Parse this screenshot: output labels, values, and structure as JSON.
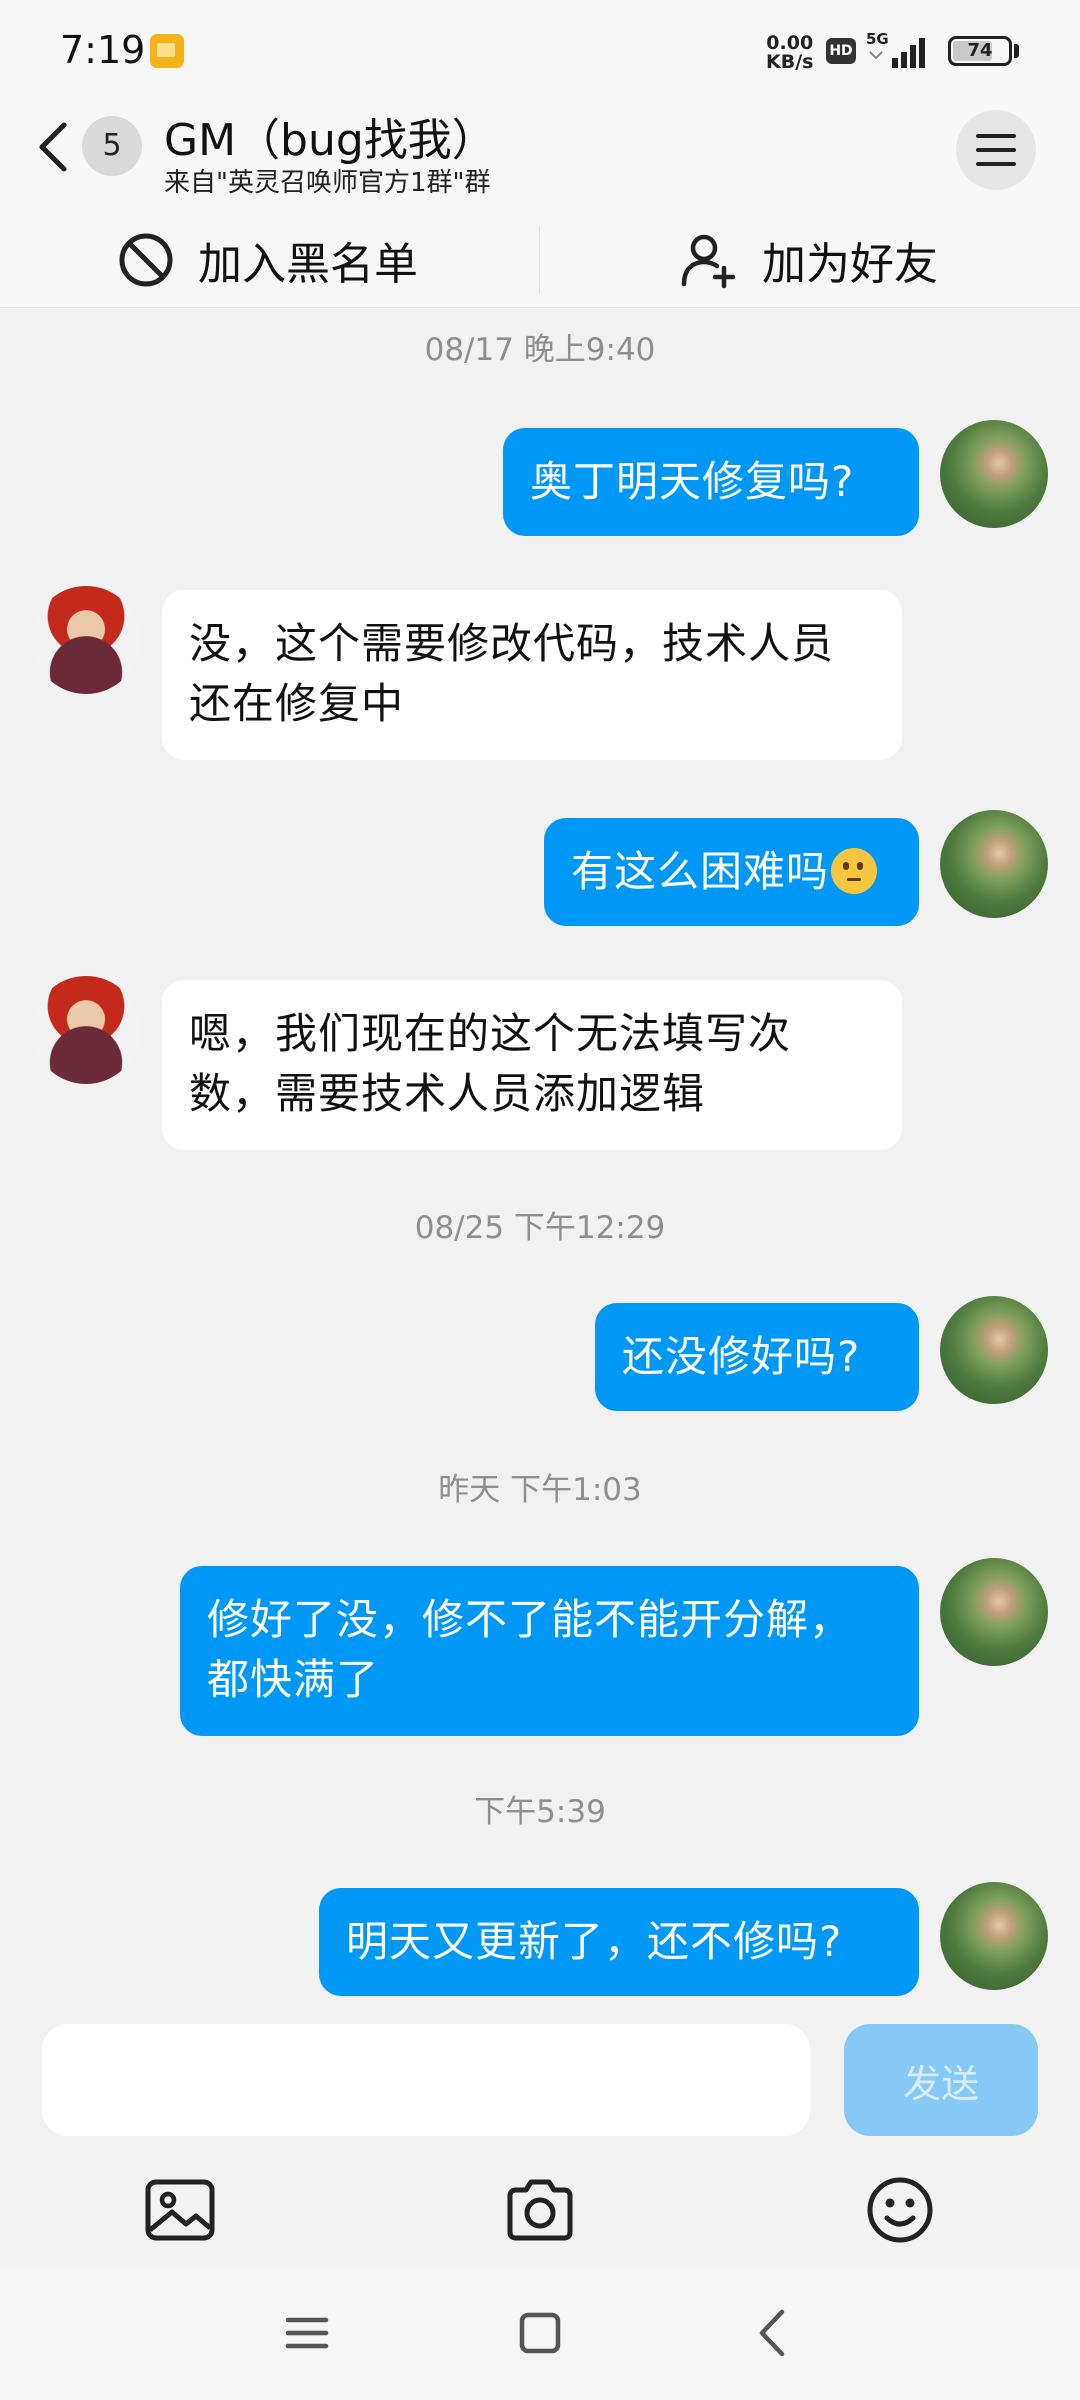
{
  "status_bar": {
    "time": "7:19",
    "speed_value": "0.00",
    "speed_unit": "KB/s",
    "hd_badge": "HD",
    "network": "5G",
    "battery": "74",
    "battery_level": 0.74
  },
  "header": {
    "unread_count": "5",
    "title": "GM（bug找我）",
    "subtitle": "来自\"英灵召唤师官方1群\"群",
    "back_icon": "chevron-left-icon",
    "menu_icon": "hamburger-menu-icon"
  },
  "actions": {
    "block_label": "加入黑名单",
    "block_icon": "block-icon",
    "add_friend_label": "加为好友",
    "add_friend_icon": "add-user-icon"
  },
  "messages": [
    {
      "type": "time",
      "text": "08/17 晚上9:40"
    },
    {
      "type": "out",
      "text": "奥丁明天修复吗?"
    },
    {
      "type": "in",
      "lines": [
        "没，这个需要修改代码，技术人员",
        "还在修复中"
      ]
    },
    {
      "type": "out",
      "text": "有这么困难吗",
      "emoji": "thinking-face-emoji"
    },
    {
      "type": "in",
      "lines": [
        "嗯，我们现在的这个无法填写次",
        "数，需要技术人员添加逻辑"
      ]
    },
    {
      "type": "time",
      "text": "08/25 下午12:29"
    },
    {
      "type": "out",
      "text": "还没修好吗?"
    },
    {
      "type": "time",
      "text": "昨天 下午1:03"
    },
    {
      "type": "out",
      "lines": [
        "修好了没，修不了能不能开分解，",
        "都快满了"
      ]
    },
    {
      "type": "time",
      "text": "下午5:39"
    },
    {
      "type": "out",
      "text": "明天又更新了，还不修吗?"
    }
  ],
  "input": {
    "value": "",
    "placeholder": "",
    "send_label": "发送"
  },
  "toolbar": {
    "icons": [
      "image-icon",
      "camera-icon",
      "emoji-smile-icon"
    ]
  },
  "nav": {
    "icons": [
      "recent-apps-icon",
      "home-icon",
      "back-icon"
    ]
  },
  "colors": {
    "outgoing_bubble": "#0098f7",
    "incoming_bubble": "#ffffff",
    "background": "#f1f1f1",
    "send_button_disabled": "#86c8f6"
  }
}
